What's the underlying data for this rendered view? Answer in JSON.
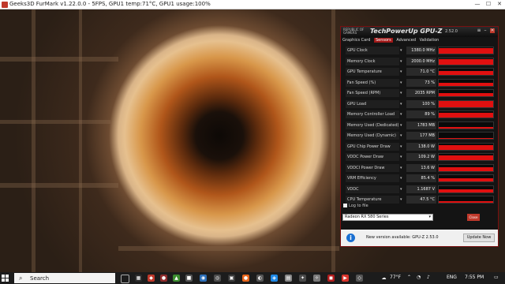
{
  "furmark": {
    "title": "Geeks3D FurMark v1.22.0.0 - 5FPS, GPU1 temp:71°C, GPU1 usage:100%",
    "controls": {
      "minimize": "—",
      "maximize": "☐",
      "close": "✕"
    }
  },
  "gpuz": {
    "app_title": "TechPowerUp GPU-Z",
    "version": "2.52.0",
    "logo_text": "REPUBLIC OF GAMERS",
    "tabs": [
      "Graphics Card",
      "Sensors",
      "Advanced",
      "Validation"
    ],
    "active_tab": "Sensors",
    "sensors": [
      {
        "label": "GPU Clock",
        "value": "1380.0 MHz",
        "level": 0.85
      },
      {
        "label": "Memory Clock",
        "value": "2000.0 MHz",
        "level": 0.85
      },
      {
        "label": "GPU Temperature",
        "value": "71.0 °C",
        "level": 0.6
      },
      {
        "label": "Fan Speed (%)",
        "value": "73 %",
        "level": 0.5
      },
      {
        "label": "Fan Speed (RPM)",
        "value": "2035 RPM",
        "level": 0.45
      },
      {
        "label": "GPU Load",
        "value": "100 %",
        "level": 0.9
      },
      {
        "label": "Memory Controller Load",
        "value": "89 %",
        "level": 0.8
      },
      {
        "label": "Memory Used (Dedicated)",
        "value": "1783 MB",
        "level": 0.2
      },
      {
        "label": "Memory Used (Dynamic)",
        "value": "177 MB",
        "level": 0.1
      },
      {
        "label": "GPU Chip Power Draw",
        "value": "138.0 W",
        "level": 0.75
      },
      {
        "label": "VDDC Power Draw",
        "value": "109.2 W",
        "level": 0.7
      },
      {
        "label": "VDDCI Power Draw",
        "value": "13.6 W",
        "level": 0.55
      },
      {
        "label": "VRM Efficiency",
        "value": "85.4 %",
        "level": 0.55
      },
      {
        "label": "VDDC",
        "value": "1.1687 V",
        "level": 0.4
      },
      {
        "label": "CPU Temperature",
        "value": "47.5 °C",
        "level": 0.3
      }
    ],
    "log_to_file": "Log to file",
    "gpu_select": "Radeon RX 580 Series",
    "close_button": "Close",
    "update": {
      "message": "New version available: GPU-Z 2.53.0",
      "button": "Update Now"
    },
    "accent_color": "#e01010"
  },
  "taskbar": {
    "search_placeholder": "Search",
    "weather": "77°F",
    "language": "ENG",
    "time": "7:55 PM"
  }
}
